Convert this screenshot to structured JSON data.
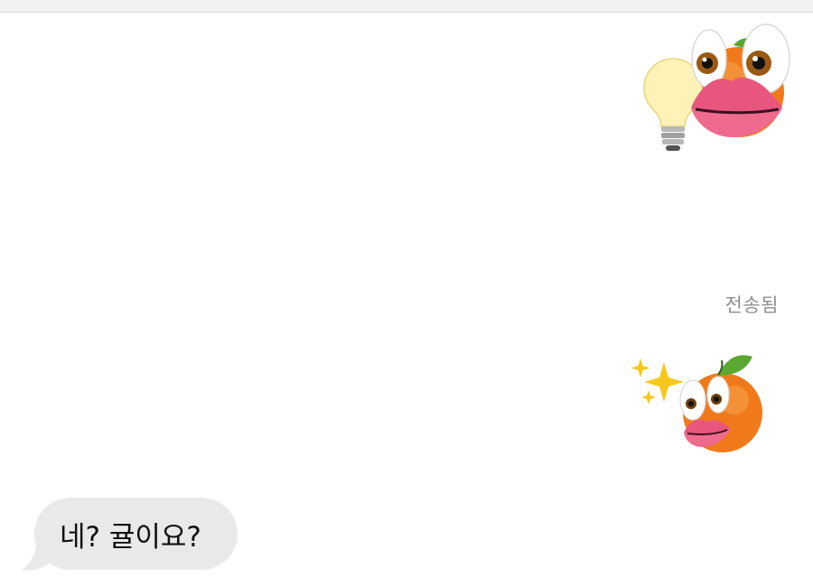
{
  "conversation": {
    "delivered_status": "전송됨",
    "received_message": "네? 귤이요?"
  },
  "stickers": [
    {
      "name": "lightbulb-with-orange-lips-sticker",
      "icons": [
        "light-bulb-icon",
        "eyes-icon",
        "lips-icon",
        "tangerine-icon"
      ]
    },
    {
      "name": "sparkles-tangerine-face-sticker",
      "icons": [
        "sparkles-icon",
        "tangerine-icon",
        "eyes-icon",
        "lips-icon"
      ]
    }
  ],
  "colors": {
    "background": "#ffffff",
    "received_bubble": "#e9e9eb",
    "status_text": "#8e8e93",
    "message_text": "#111111",
    "tangerine": "#f07a1a",
    "lips": "#e8557d"
  }
}
